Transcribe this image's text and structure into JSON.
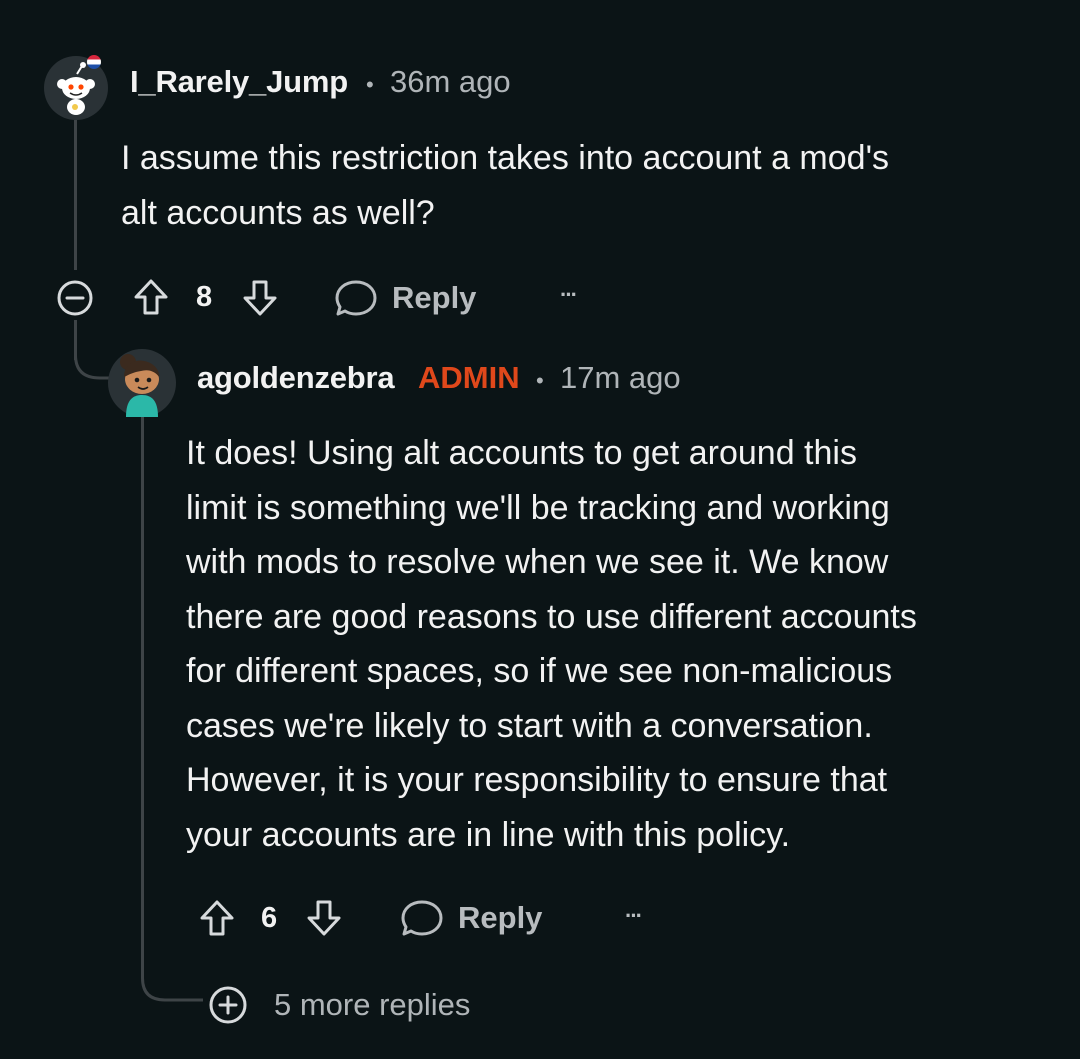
{
  "comments": [
    {
      "username": "I_Rarely_Jump",
      "separator": "•",
      "time": "36m ago",
      "body_lines": [
        "I assume this restriction takes into account a mod's",
        "alt accounts as well?"
      ],
      "score": "8",
      "reply_label": "Reply",
      "more_label": "···"
    },
    {
      "username": "agoldenzebra",
      "badge": "ADMIN",
      "separator": "•",
      "time": "17m ago",
      "body_lines": [
        "It does! Using alt accounts to get around this",
        "limit is something we'll be tracking and working",
        "with mods to resolve when we see it. We know",
        "there are good reasons to use different accounts",
        "for different spaces, so if we see non-malicious",
        "cases we're likely to start with a conversation.",
        "However, it is your responsibility to ensure that",
        "your accounts are in line with this policy."
      ],
      "score": "6",
      "reply_label": "Reply",
      "more_label": "···"
    }
  ],
  "more_replies_label": "5 more replies",
  "icons": {
    "collapse": "minus-circle-icon",
    "upvote": "arrow-up-icon",
    "downvote": "arrow-down-icon",
    "reply": "speech-bubble-icon",
    "overflow": "more-horizontal-icon",
    "expand": "plus-circle-icon"
  },
  "colors": {
    "background": "#0b1416",
    "admin": "#e0481b",
    "thread_line": "#3e4447"
  }
}
